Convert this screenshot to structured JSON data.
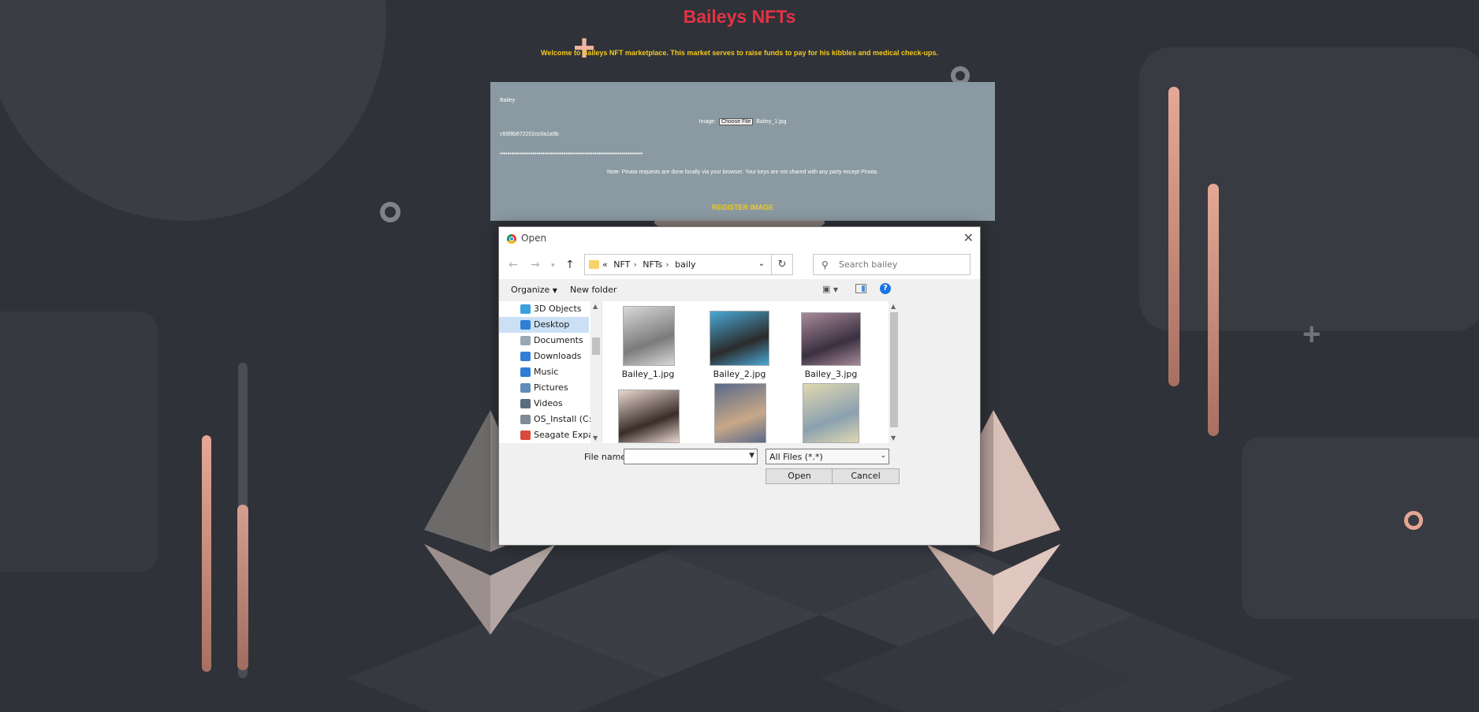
{
  "site": {
    "title": "Baileys NFTs",
    "welcome": "Welcome to Baileys NFT marketplace. This market serves to raise funds to pay for his kibbles and medical check-ups."
  },
  "form": {
    "name_value": "Bailey",
    "image_label": "Image:",
    "choose_file_label": "Choose File",
    "chosen_file": "Bailey_1.jpg",
    "hash_value": "c69f8b672202cc0a1a9b",
    "masked_key": "••••••••••••••••••••••••••••••••••••••••••••••••••••••••••••••••••••••••••",
    "note": "Note: Pinata requests are done locally via your browser. Your keys are not shared with any party except Pinata.",
    "register_label": "REGISTER IMAGE"
  },
  "dialog": {
    "title": "Open",
    "breadcrumb": [
      "NFT",
      "NFTs",
      "baily"
    ],
    "breadcrumb_prefix": "«",
    "search_placeholder": "Search bailey",
    "organize_label": "Organize",
    "new_folder_label": "New folder",
    "sidebar": [
      {
        "label": "3D Objects",
        "icon": "3d-objects-icon",
        "color": "#3aa0e0"
      },
      {
        "label": "Desktop",
        "icon": "desktop-icon",
        "color": "#2f7fd6",
        "selected": true
      },
      {
        "label": "Documents",
        "icon": "documents-icon",
        "color": "#9aa7b5"
      },
      {
        "label": "Downloads",
        "icon": "downloads-icon",
        "color": "#2f7fd6"
      },
      {
        "label": "Music",
        "icon": "music-icon",
        "color": "#2f7fd6"
      },
      {
        "label": "Pictures",
        "icon": "pictures-icon",
        "color": "#5f8fb8"
      },
      {
        "label": "Videos",
        "icon": "videos-icon",
        "color": "#5a6c80"
      },
      {
        "label": "OS_Install (C:)",
        "icon": "drive-icon",
        "color": "#7f8a96"
      },
      {
        "label": "Seagate Expansi",
        "icon": "external-drive-icon",
        "color": "#d94b3b"
      }
    ],
    "files": [
      {
        "name": "Bailey_1.jpg",
        "colors": [
          "#d8d8d8",
          "#7b7b7b"
        ]
      },
      {
        "name": "Bailey_2.jpg",
        "colors": [
          "#4aa9d6",
          "#2b2b2b"
        ]
      },
      {
        "name": "Bailey_3.jpg",
        "colors": [
          "#a88a9a",
          "#3a3040"
        ]
      },
      {
        "name": "",
        "colors": [
          "#e8d8d0",
          "#3a2c28"
        ]
      },
      {
        "name": "",
        "colors": [
          "#5a6a8a",
          "#c8a888"
        ]
      },
      {
        "name": "",
        "colors": [
          "#e0d8b0",
          "#8aa0b0"
        ]
      }
    ],
    "file_name_label": "File name:",
    "file_name_value": "",
    "filter_value": "All Files (*.*)",
    "open_label": "Open",
    "cancel_label": "Cancel"
  }
}
